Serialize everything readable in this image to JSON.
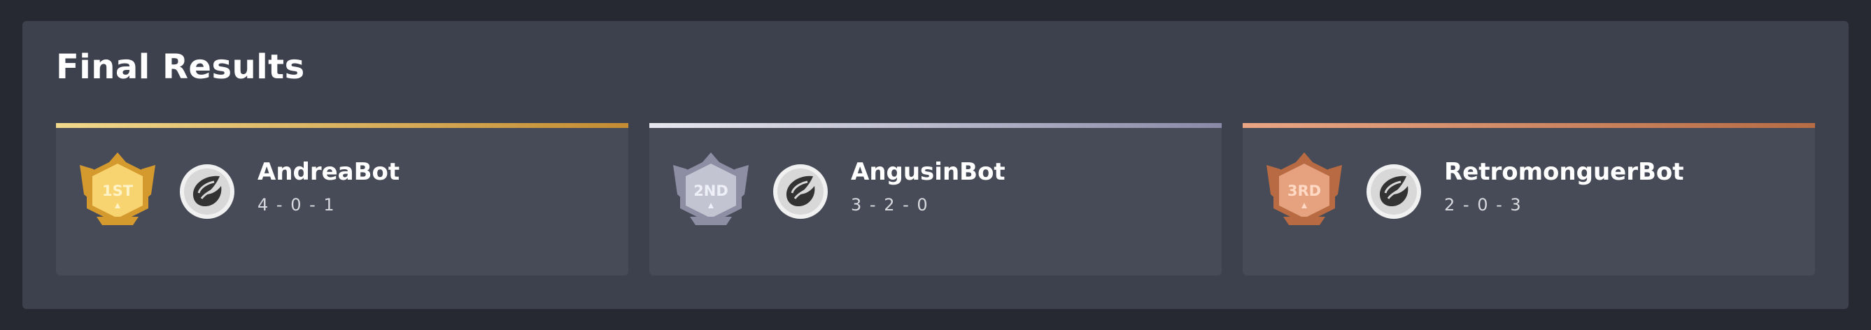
{
  "title": "Final Results",
  "results": [
    {
      "place": "1ST",
      "name": "AndreaBot",
      "record": "4 - 0 - 1",
      "medal_icon": "gold-medal-icon",
      "colors": {
        "bar_start": "#f1d98b",
        "bar_end": "#c48c34",
        "medal_light": "#f8d470",
        "medal_dark": "#d59a2e",
        "medal_text": "#fff3c8"
      }
    },
    {
      "place": "2ND",
      "name": "AngusinBot",
      "record": "3 - 2 - 0",
      "medal_icon": "silver-medal-icon",
      "colors": {
        "bar_start": "#e7e8ef",
        "bar_end": "#8a8aa8",
        "medal_light": "#c3c4d2",
        "medal_dark": "#8d8ea3",
        "medal_text": "#eef0f7"
      }
    },
    {
      "place": "3RD",
      "name": "RetromonguerBot",
      "record": "2 - 0 - 3",
      "medal_icon": "bronze-medal-icon",
      "colors": {
        "bar_start": "#eaa684",
        "bar_end": "#b66c45",
        "medal_light": "#e6a17f",
        "medal_dark": "#b86a43",
        "medal_text": "#ffd9c4"
      }
    }
  ],
  "avatar_icon": "bot-avatar-icon"
}
